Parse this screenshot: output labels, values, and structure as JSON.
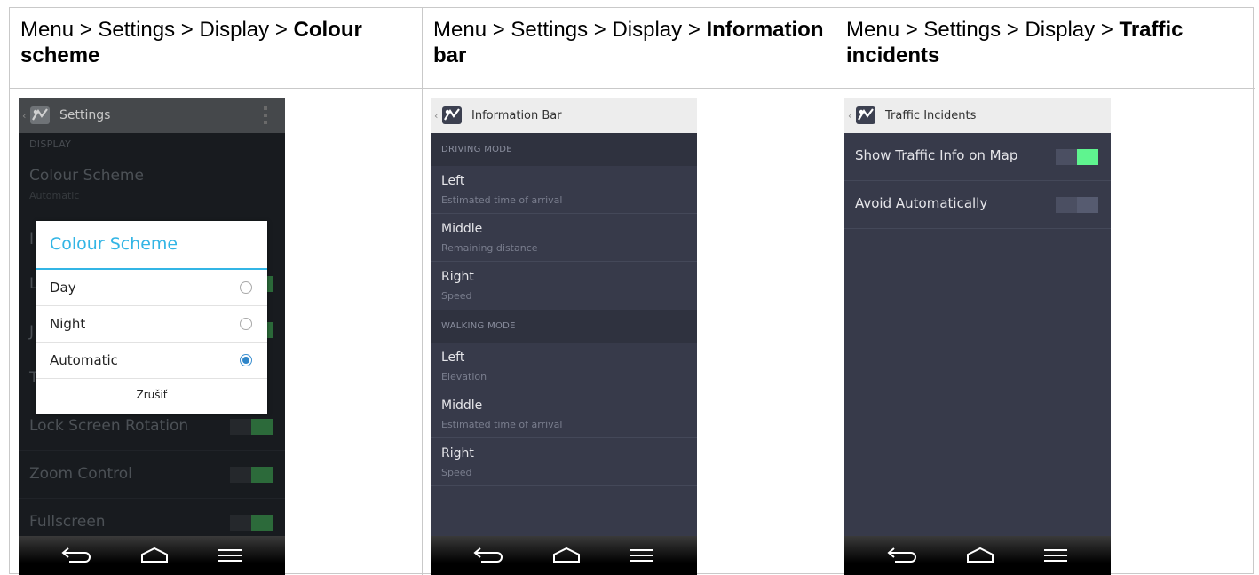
{
  "columns": [
    {
      "header_path": "Menu > Settings > Display > ",
      "header_bold": "Colour scheme",
      "screen": {
        "appbar_title": "Settings",
        "section": "DISPLAY",
        "colour_scheme_title": "Colour Scheme",
        "colour_scheme_value": "Automatic",
        "peek_letters": [
          "I",
          "L",
          "J",
          "T"
        ],
        "lock_rotation": "Lock Screen Rotation",
        "zoom_control": "Zoom Control",
        "fullscreen": "Fullscreen",
        "dialog": {
          "title": "Colour Scheme",
          "options": [
            {
              "label": "Day",
              "selected": false
            },
            {
              "label": "Night",
              "selected": false
            },
            {
              "label": "Automatic",
              "selected": true
            }
          ],
          "cancel": "Zrušiť"
        }
      }
    },
    {
      "header_path": "Menu > Settings > Display > ",
      "header_bold": "Information bar",
      "screen": {
        "appbar_title": "Information Bar",
        "driving_section": "DRIVING MODE",
        "driving": [
          {
            "title": "Left",
            "subtitle": "Estimated time of arrival"
          },
          {
            "title": "Middle",
            "subtitle": "Remaining distance"
          },
          {
            "title": "Right",
            "subtitle": "Speed"
          }
        ],
        "walking_section": "WALKING MODE",
        "walking": [
          {
            "title": "Left",
            "subtitle": "Elevation"
          },
          {
            "title": "Middle",
            "subtitle": "Estimated time of arrival"
          },
          {
            "title": "Right",
            "subtitle": "Speed"
          }
        ]
      }
    },
    {
      "header_path": "Menu > Settings > Display > ",
      "header_bold": "Traffic incidents",
      "screen": {
        "appbar_title": "Traffic Incidents",
        "items": [
          {
            "label": "Show Traffic Info on Map",
            "enabled": true
          },
          {
            "label": "Avoid Automatically",
            "enabled": false
          }
        ]
      }
    }
  ],
  "colors": {
    "accent": "#33b5e5",
    "toggle_on": "#5ff48f",
    "list_bg": "#373a4a"
  },
  "icons": [
    "back-chevron-icon",
    "app-logo-icon",
    "nav-back-icon",
    "nav-home-icon",
    "nav-menu-icon",
    "overflow-menu-icon"
  ]
}
